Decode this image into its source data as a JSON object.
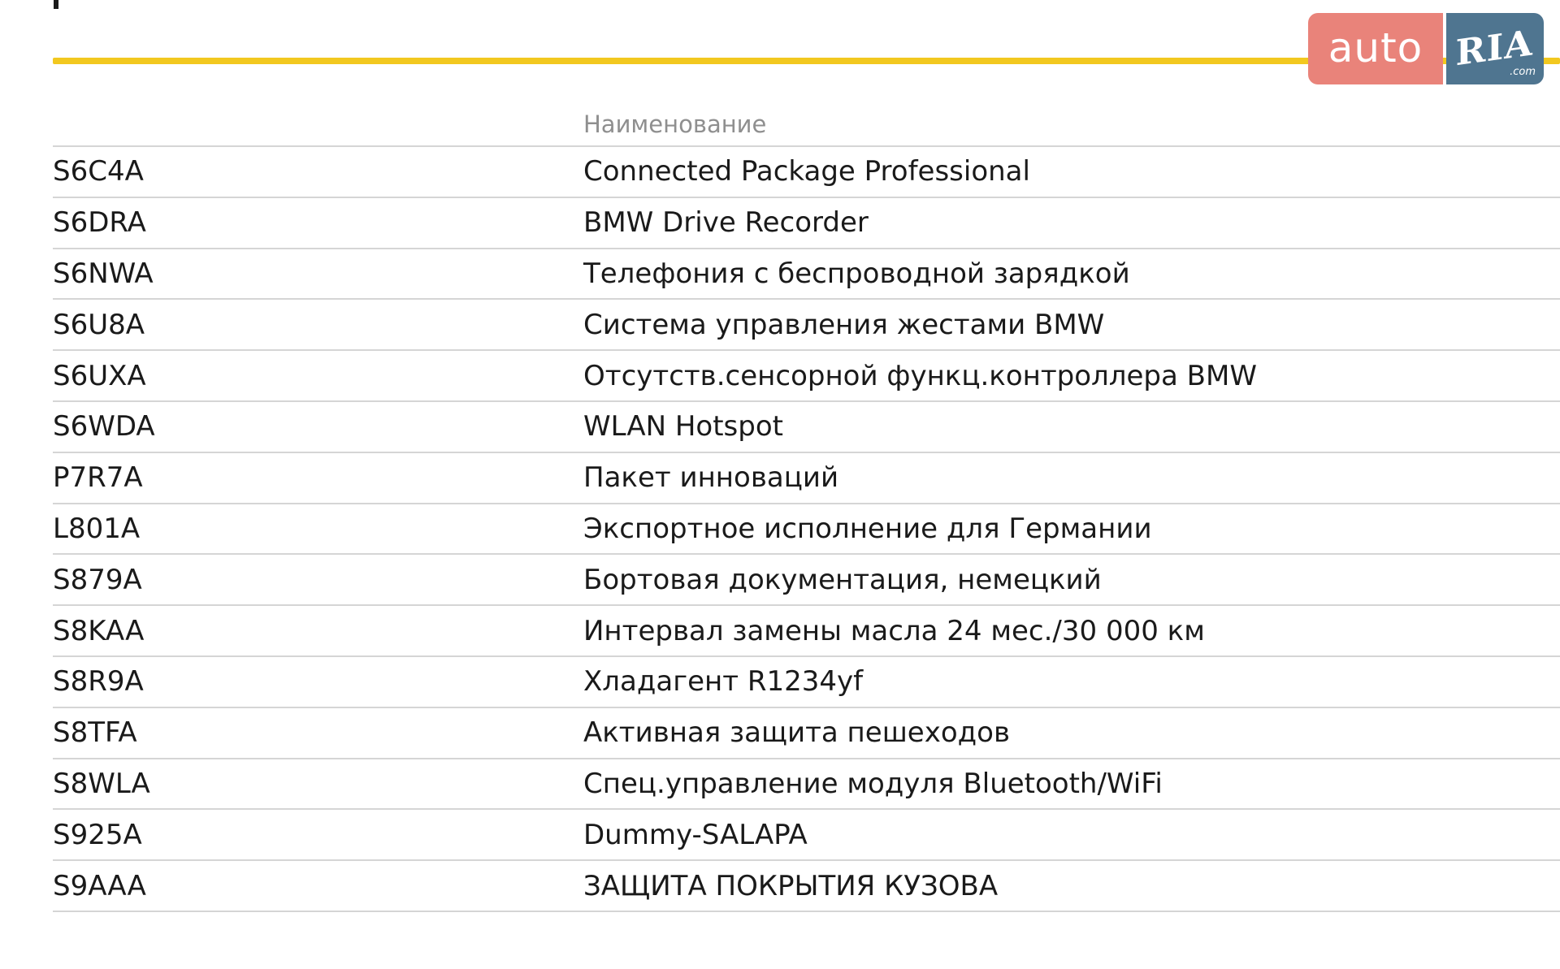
{
  "logo": {
    "auto_text": "auto",
    "ria_text": "RIA",
    "com_text": ".com",
    "auto_color": "#e9837a",
    "ria_color": "#4f7590"
  },
  "accent_color": "#f2c81f",
  "table": {
    "header": {
      "code": "",
      "name": "Наименование"
    },
    "rows": [
      {
        "code": "S6C4A",
        "name": "Connected Package Professional"
      },
      {
        "code": "S6DRA",
        "name": "BMW Drive Recorder"
      },
      {
        "code": "S6NWA",
        "name": "Телефония с беспроводной зарядкой"
      },
      {
        "code": "S6U8A",
        "name": "Система управления жестами BMW"
      },
      {
        "code": "S6UXA",
        "name": "Отсутств.сенсорной функц.контроллера BMW"
      },
      {
        "code": "S6WDA",
        "name": "WLAN Hotspot"
      },
      {
        "code": "P7R7A",
        "name": "Пакет инноваций"
      },
      {
        "code": "L801A",
        "name": "Экспортное исполнение для Германии"
      },
      {
        "code": "S879A",
        "name": "Бортовая документация, немецкий"
      },
      {
        "code": "S8KAA",
        "name": "Интервал замены масла 24 мес./30 000 км"
      },
      {
        "code": "S8R9A",
        "name": "Хладагент R1234yf"
      },
      {
        "code": "S8TFA",
        "name": "Активная защита пешеходов"
      },
      {
        "code": "S8WLA",
        "name": "Спец.управление модуля Bluetooth/WiFi"
      },
      {
        "code": "S925A",
        "name": "Dummy-SALAPA"
      },
      {
        "code": "S9AAA",
        "name": "ЗАЩИТА ПОКРЫТИЯ КУЗОВА"
      }
    ]
  }
}
